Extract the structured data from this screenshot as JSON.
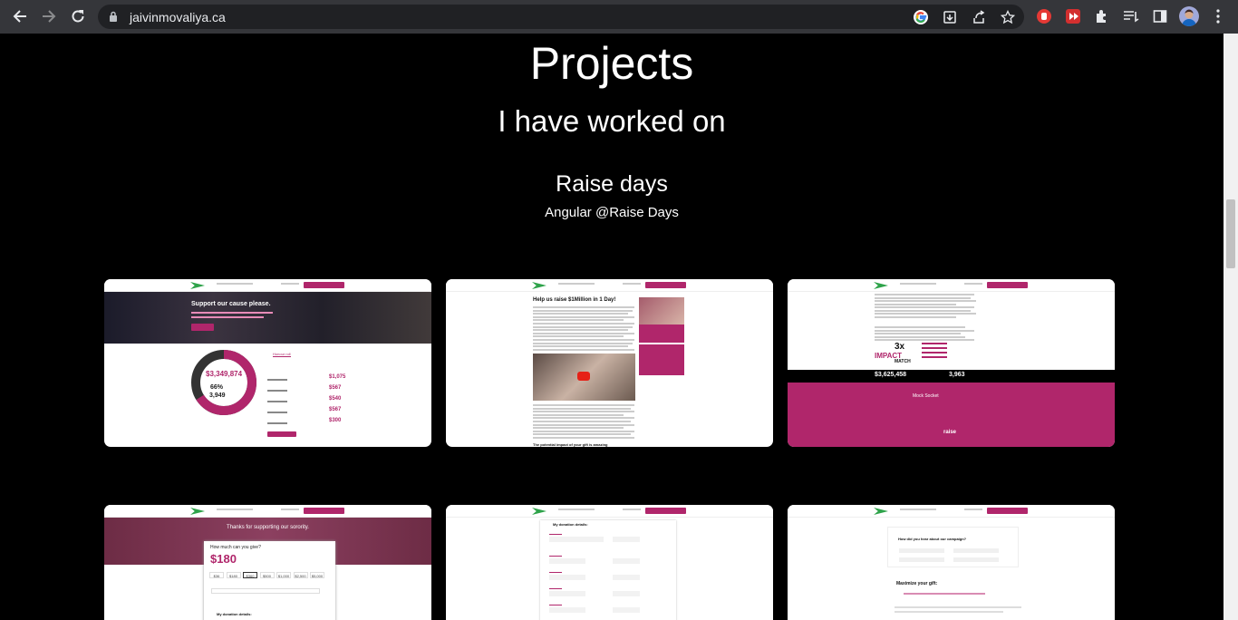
{
  "browser": {
    "url": "jaivinmovaliya.ca"
  },
  "page": {
    "title": "Projects",
    "subtitle": "I have worked on",
    "project": {
      "name": "Raise days",
      "tech": "Angular @Raise Days"
    }
  },
  "cards": {
    "c1": {
      "headline": "Support our cause please.",
      "amount": "$3,349,874",
      "pct": "66%",
      "count": "3,949",
      "tab1": "Honour roll",
      "amounts": [
        "$1,075",
        "$567",
        "$540",
        "$567",
        "$300"
      ]
    },
    "c2": {
      "headline": "Help us raise $1Million in 1 Day!",
      "footer": "The potential impact of your gift is amazing"
    },
    "c3": {
      "impact": "3x",
      "impact_word": "IMPACT",
      "match": "MATCH",
      "total": "$3,625,458",
      "donors": "3,963",
      "sponsor": "Mock Socket",
      "brand": "raise"
    },
    "c4": {
      "thanks": "Thanks for supporting our sorority.",
      "question": "How much can you give?",
      "amount": "$180",
      "options": [
        "$36",
        "$180",
        "$360",
        "$500",
        "$1,000",
        "$2,500",
        "$5,000"
      ],
      "details": "My donation details:"
    },
    "c5": {
      "details": "My donation details:"
    },
    "c6": {
      "hear": "How did you hear about our campaign?",
      "maximize": "Maximize your gift:"
    }
  },
  "colors": {
    "accent": "#b0266b",
    "brand_green": "#2ea34a"
  },
  "icons": [
    "back-icon",
    "forward-icon",
    "reload-icon",
    "lock-icon",
    "google-icon",
    "install-icon",
    "share-icon",
    "star-icon",
    "ext-red-icon",
    "ext-red2-icon",
    "puzzle-icon",
    "reading-list-icon",
    "sidepanel-icon",
    "avatar",
    "kebab-icon"
  ]
}
